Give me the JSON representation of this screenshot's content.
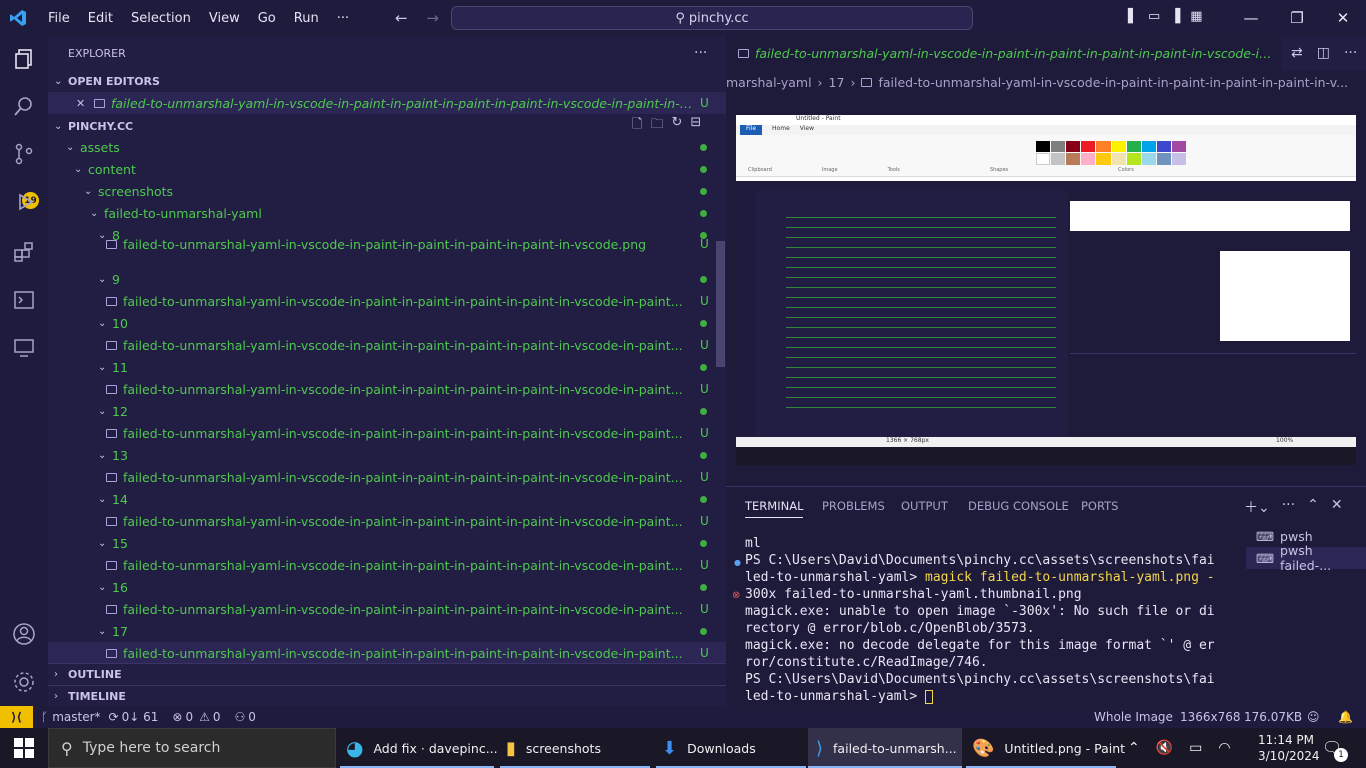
{
  "titlebar": {
    "menu": [
      "File",
      "Edit",
      "Selection",
      "View",
      "Go",
      "Run",
      "···"
    ],
    "search": "pinchy.cc"
  },
  "activity": {
    "scm_badge": "19"
  },
  "explorer": {
    "header": "EXPLORER",
    "open_editors_title": "OPEN EDITORS",
    "open_editor_file": "failed-to-unmarshal-yaml-in-vscode-in-paint-in-paint-in-paint-in-paint-in-vscode-in-paint-in-vs...",
    "open_editor_badge": "U",
    "project_title": "PINCHY.CC",
    "folders": [
      "assets",
      "content",
      "screenshots",
      "failed-to-unmarshal-yaml"
    ],
    "rows": [
      {
        "folder": "8",
        "file": "failed-to-unmarshal-yaml-in-vscode-in-paint-in-paint-in-paint-in-paint-in-vscode.png"
      },
      {
        "folder": "9",
        "file": "failed-to-unmarshal-yaml-in-vscode-in-paint-in-paint-in-paint-in-paint-in-vscode-in-paint..."
      },
      {
        "folder": "10",
        "file": "failed-to-unmarshal-yaml-in-vscode-in-paint-in-paint-in-paint-in-paint-in-vscode-in-paint..."
      },
      {
        "folder": "11",
        "file": "failed-to-unmarshal-yaml-in-vscode-in-paint-in-paint-in-paint-in-paint-in-vscode-in-paint..."
      },
      {
        "folder": "12",
        "file": "failed-to-unmarshal-yaml-in-vscode-in-paint-in-paint-in-paint-in-paint-in-vscode-in-paint..."
      },
      {
        "folder": "13",
        "file": "failed-to-unmarshal-yaml-in-vscode-in-paint-in-paint-in-paint-in-paint-in-vscode-in-paint..."
      },
      {
        "folder": "14",
        "file": "failed-to-unmarshal-yaml-in-vscode-in-paint-in-paint-in-paint-in-paint-in-vscode-in-paint..."
      },
      {
        "folder": "15",
        "file": "failed-to-unmarshal-yaml-in-vscode-in-paint-in-paint-in-paint-in-paint-in-vscode-in-paint..."
      },
      {
        "folder": "16",
        "file": "failed-to-unmarshal-yaml-in-vscode-in-paint-in-paint-in-paint-in-paint-in-vscode-in-paint..."
      },
      {
        "folder": "17",
        "file": "failed-to-unmarshal-yaml-in-vscode-in-paint-in-paint-in-paint-in-paint-in-vscode-in-paint..."
      }
    ],
    "file_badge": "U",
    "outline_title": "OUTLINE",
    "timeline_title": "TIMELINE"
  },
  "editor": {
    "tab_title": "failed-to-unmarshal-yaml-in-vscode-in-paint-in-paint-in-paint-in-paint-in-vscode-in-p",
    "breadcrumb": [
      "marshal-yaml",
      "17",
      "failed-to-unmarshal-yaml-in-vscode-in-paint-in-paint-in-paint-in-paint-in-v..."
    ],
    "paint_title": "Untitled - Paint",
    "paint_tabs": [
      "File",
      "Home",
      "View"
    ],
    "paint_groups": [
      "Clipboard",
      "Image",
      "Tools",
      "Shapes",
      "Colors"
    ],
    "paint_status": "1366 × 768px",
    "paint_zoom": "100%"
  },
  "panel": {
    "tabs": [
      "TERMINAL",
      "PROBLEMS",
      "OUTPUT",
      "DEBUG CONSOLE",
      "PORTS"
    ],
    "terminal_lines": [
      {
        "text": "ml",
        "cmd": ""
      },
      {
        "text": "PS C:\\Users\\David\\Documents\\pinchy.cc\\assets\\screenshots\\fai",
        "cmd": ""
      },
      {
        "text": "led-to-unmarshal-yaml> ",
        "cmd": "magick failed-to-unmarshal-yaml.png -"
      },
      {
        "text": "300x failed-to-unmarshal-yaml.thumbnail.png",
        "cmd": ""
      },
      {
        "text": "magick.exe: unable to open image `-300x': No such file or di",
        "cmd": ""
      },
      {
        "text": "rectory @ error/blob.c/OpenBlob/3573.",
        "cmd": ""
      },
      {
        "text": "magick.exe: no decode delegate for this image format `' @ er",
        "cmd": ""
      },
      {
        "text": "ror/constitute.c/ReadImage/746.",
        "cmd": ""
      },
      {
        "text": "PS C:\\Users\\David\\Documents\\pinchy.cc\\assets\\screenshots\\fai",
        "cmd": ""
      },
      {
        "text": "led-to-unmarshal-yaml> ",
        "cmd": ""
      }
    ],
    "shells": [
      "pwsh",
      "pwsh  failed-..."
    ]
  },
  "statusbar": {
    "branch": "master*",
    "sync": "0↓ 61",
    "problems_errors": "0",
    "problems_warnings": "0",
    "ports": "0",
    "whole_image": "Whole Image",
    "dimensions": "1366x768",
    "size": "176.07KB"
  },
  "taskbar": {
    "search_placeholder": "Type here to search",
    "apps": [
      "Add fix · davepinc...",
      "screenshots",
      "Downloads",
      "failed-to-unmarsh...",
      "Untitled.png - Paint"
    ],
    "time": "11:14 PM",
    "date": "3/10/2024",
    "notifications": "1"
  },
  "colors": {
    "accent_green": "#4ec94e",
    "bg": "#1e1a3a",
    "sidebar_bg": "#221d43",
    "badge_yellow": "#f0c000"
  }
}
